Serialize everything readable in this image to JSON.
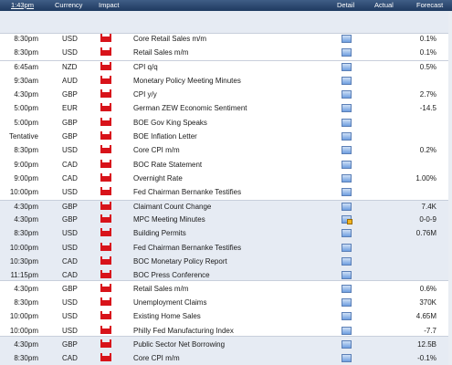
{
  "header": {
    "time": "1:43pm",
    "currency": "Currency",
    "impact": "Impact",
    "detail": "Detail",
    "actual": "Actual",
    "forecast": "Forecast"
  },
  "colors": {
    "header_bg": "#2b4a74",
    "band_bg": "#e6ebf3",
    "impact_high": "#d8131a"
  },
  "rows": [
    {
      "time": "8:30pm",
      "currency": "USD",
      "event": "Core Retail Sales m/m",
      "forecast": "0.1%"
    },
    {
      "time": "8:30pm",
      "currency": "USD",
      "event": "Retail Sales m/m",
      "forecast": "0.1%"
    },
    {
      "time": "6:45am",
      "currency": "NZD",
      "event": "CPI q/q",
      "forecast": "0.5%"
    },
    {
      "time": "9:30am",
      "currency": "AUD",
      "event": "Monetary Policy Meeting Minutes",
      "forecast": ""
    },
    {
      "time": "4:30pm",
      "currency": "GBP",
      "event": "CPI y/y",
      "forecast": "2.7%"
    },
    {
      "time": "5:00pm",
      "currency": "EUR",
      "event": "German ZEW Economic Sentiment",
      "forecast": "-14.5"
    },
    {
      "time": "5:00pm",
      "currency": "GBP",
      "event": "BOE Gov King Speaks",
      "forecast": ""
    },
    {
      "time": "Tentative",
      "currency": "GBP",
      "event": "BOE Inflation Letter",
      "forecast": ""
    },
    {
      "time": "8:30pm",
      "currency": "USD",
      "event": "Core CPI m/m",
      "forecast": "0.2%"
    },
    {
      "time": "9:00pm",
      "currency": "CAD",
      "event": "BOC Rate Statement",
      "forecast": ""
    },
    {
      "time": "9:00pm",
      "currency": "CAD",
      "event": "Overnight Rate",
      "forecast": "1.00%"
    },
    {
      "time": "10:00pm",
      "currency": "USD",
      "event": "Fed Chairman Bernanke Testifies",
      "forecast": ""
    },
    {
      "time": "4:30pm",
      "currency": "GBP",
      "event": "Claimant Count Change",
      "forecast": "7.4K"
    },
    {
      "time": "4:30pm",
      "currency": "GBP",
      "event": "MPC Meeting Minutes",
      "forecast": "0-0-9"
    },
    {
      "time": "8:30pm",
      "currency": "USD",
      "event": "Building Permits",
      "forecast": "0.76M"
    },
    {
      "time": "10:00pm",
      "currency": "USD",
      "event": "Fed Chairman Bernanke Testifies",
      "forecast": ""
    },
    {
      "time": "10:30pm",
      "currency": "CAD",
      "event": "BOC Monetary Policy Report",
      "forecast": ""
    },
    {
      "time": "11:15pm",
      "currency": "CAD",
      "event": "BOC Press Conference",
      "forecast": ""
    },
    {
      "time": "4:30pm",
      "currency": "GBP",
      "event": "Retail Sales m/m",
      "forecast": "0.6%"
    },
    {
      "time": "8:30pm",
      "currency": "USD",
      "event": "Unemployment Claims",
      "forecast": "370K"
    },
    {
      "time": "10:00pm",
      "currency": "USD",
      "event": "Existing Home Sales",
      "forecast": "4.65M"
    },
    {
      "time": "10:00pm",
      "currency": "USD",
      "event": "Philly Fed Manufacturing Index",
      "forecast": "-7.7"
    },
    {
      "time": "4:30pm",
      "currency": "GBP",
      "event": "Public Sector Net Borrowing",
      "forecast": "12.5B"
    },
    {
      "time": "8:30pm",
      "currency": "CAD",
      "event": "Core CPI m/m",
      "forecast": "-0.1%"
    }
  ]
}
